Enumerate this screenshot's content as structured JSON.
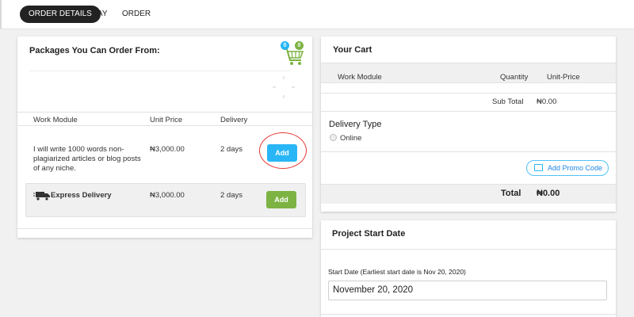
{
  "tabs": [
    {
      "label": "ORDER DETAILS"
    },
    {
      "label": "PAY"
    },
    {
      "label": "ORDER"
    }
  ],
  "packages": {
    "title": "Packages You Can Order From:",
    "cart_badges": [
      "0",
      "0"
    ],
    "columns": [
      "Work Module",
      "Unit Price",
      "Delivery"
    ],
    "rows": [
      {
        "module_lines": [
          "I will write 1000 words non-",
          "plagiarized articles or blog posts",
          "of any niche."
        ],
        "price": "₦3,000.00",
        "delivery": "2 days",
        "button": "Add"
      },
      {
        "module": "Express Delivery",
        "price": "₦3,000.00",
        "delivery": "2 days",
        "button": "Add"
      }
    ]
  },
  "cart": {
    "title": "Your Cart",
    "columns": [
      "Work Module",
      "Quantity",
      "Unit-Price"
    ],
    "subtotal_label": "Sub Total",
    "subtotal_value": "₦0.00",
    "delivery_type_label": "Delivery Type",
    "delivery_option": "Online",
    "promo_button": "Add Promo Code",
    "total_label": "Total",
    "total_value": "₦0.00"
  },
  "project": {
    "title": "Project Start Date",
    "start_label": "Start Date",
    "start_hint": "(Earliest start date is Nov 20, 2020)",
    "start_value": "November 20, 2020"
  },
  "colors": {
    "blue_button": "#29b6f6",
    "green_button": "#7cb342",
    "highlight_ring": "#e53935",
    "promo_border": "#4fc3f7"
  }
}
